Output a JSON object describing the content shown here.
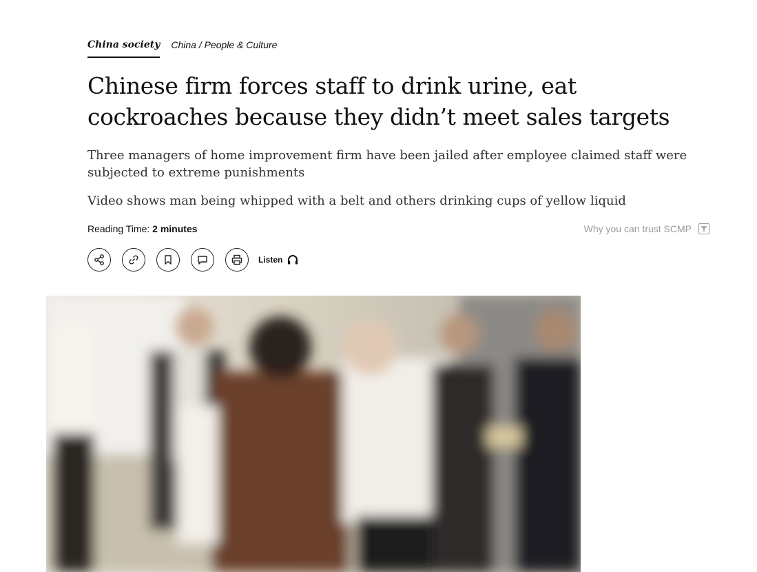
{
  "breadcrumb": {
    "primary": "China society",
    "secondary": "China / People & Culture"
  },
  "article": {
    "headline": "Chinese firm forces staff to drink urine, eat cockroaches because they didn’t meet sales targets",
    "summary": [
      "Three managers of home improvement firm have been jailed after employee claimed staff were subjected to extreme punishments",
      "Video shows man being whipped with a belt and others drinking cups of yellow liquid"
    ],
    "reading_time_label": "Reading Time:",
    "reading_time_value": "2 minutes",
    "trust_link": "Why you can trust SCMP"
  },
  "actions": {
    "icons": [
      "share-icon",
      "link-icon",
      "bookmark-icon",
      "comment-icon",
      "print-icon",
      "headphones-icon"
    ],
    "listen_label": "Listen"
  },
  "hero_image": {
    "description_icon": "photo"
  },
  "colors": {
    "text": "#111111",
    "muted": "#9a9a9a",
    "summary": "#333333"
  }
}
